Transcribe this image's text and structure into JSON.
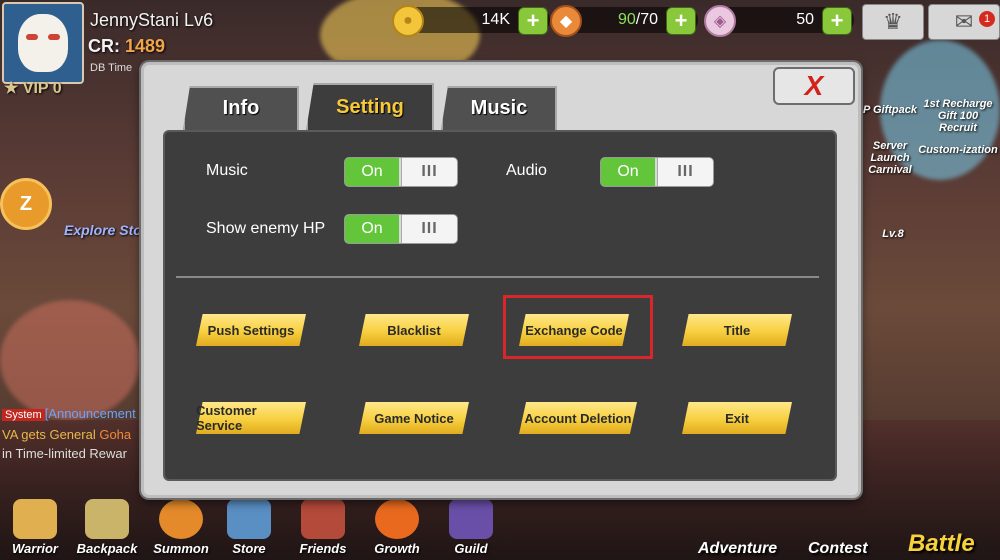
{
  "hud": {
    "player_name": "JennyStani Lv6",
    "cr_label": "CR:",
    "cr_value": "1489",
    "db_time_label": "DB Time",
    "vip": "VIP 0",
    "resources": [
      {
        "icon": "gold-coin-icon",
        "value": "14K"
      },
      {
        "icon": "stamina-drumstick-icon",
        "value_current": "90",
        "value_max": "/70"
      },
      {
        "icon": "gem-icon",
        "value": "50"
      }
    ],
    "mail_badge": "1"
  },
  "side": {
    "explore_text": "Explore Story St",
    "right_labels": [
      "P Giftpack",
      "1st Recharge Gift 100 Recruit",
      "Server Launch Carnival",
      "Custom-ization"
    ],
    "level_text": "Lv.8"
  },
  "chat": {
    "tag": "System",
    "line1": "[Announcement",
    "line2a": "VA gets General ",
    "line2b": "Goha",
    "line3": "in Time-limited Rewar"
  },
  "bottom_nav": [
    {
      "label": "Warrior"
    },
    {
      "label": "Backpack"
    },
    {
      "label": "Summon"
    },
    {
      "label": "Store"
    },
    {
      "label": "Friends"
    },
    {
      "label": "Growth"
    },
    {
      "label": "Guild"
    }
  ],
  "bottom_big": {
    "adventure": "Adventure",
    "contest": "Contest",
    "battle": "Battle"
  },
  "modal": {
    "tabs": [
      {
        "label": "Info",
        "active": false
      },
      {
        "label": "Setting",
        "active": true
      },
      {
        "label": "Music",
        "active": false
      }
    ],
    "close_label": "X",
    "settings": {
      "music_label": "Music",
      "audio_label": "Audio",
      "enemy_hp_label": "Show enemy HP",
      "toggle_on": "On",
      "toggle_knob": "III"
    },
    "buttons": [
      "Push Settings",
      "Blacklist",
      "Exchange Code",
      "Title",
      "Customer Service",
      "Game Notice",
      "Account Deletion",
      "Exit"
    ],
    "highlight_color": "#d9262b"
  },
  "colors": {
    "toggle_on": "#62c53a",
    "button_yellow": "#f7cf3f",
    "active_tab_text": "#f7c93a",
    "close_x": "#d2231a"
  }
}
